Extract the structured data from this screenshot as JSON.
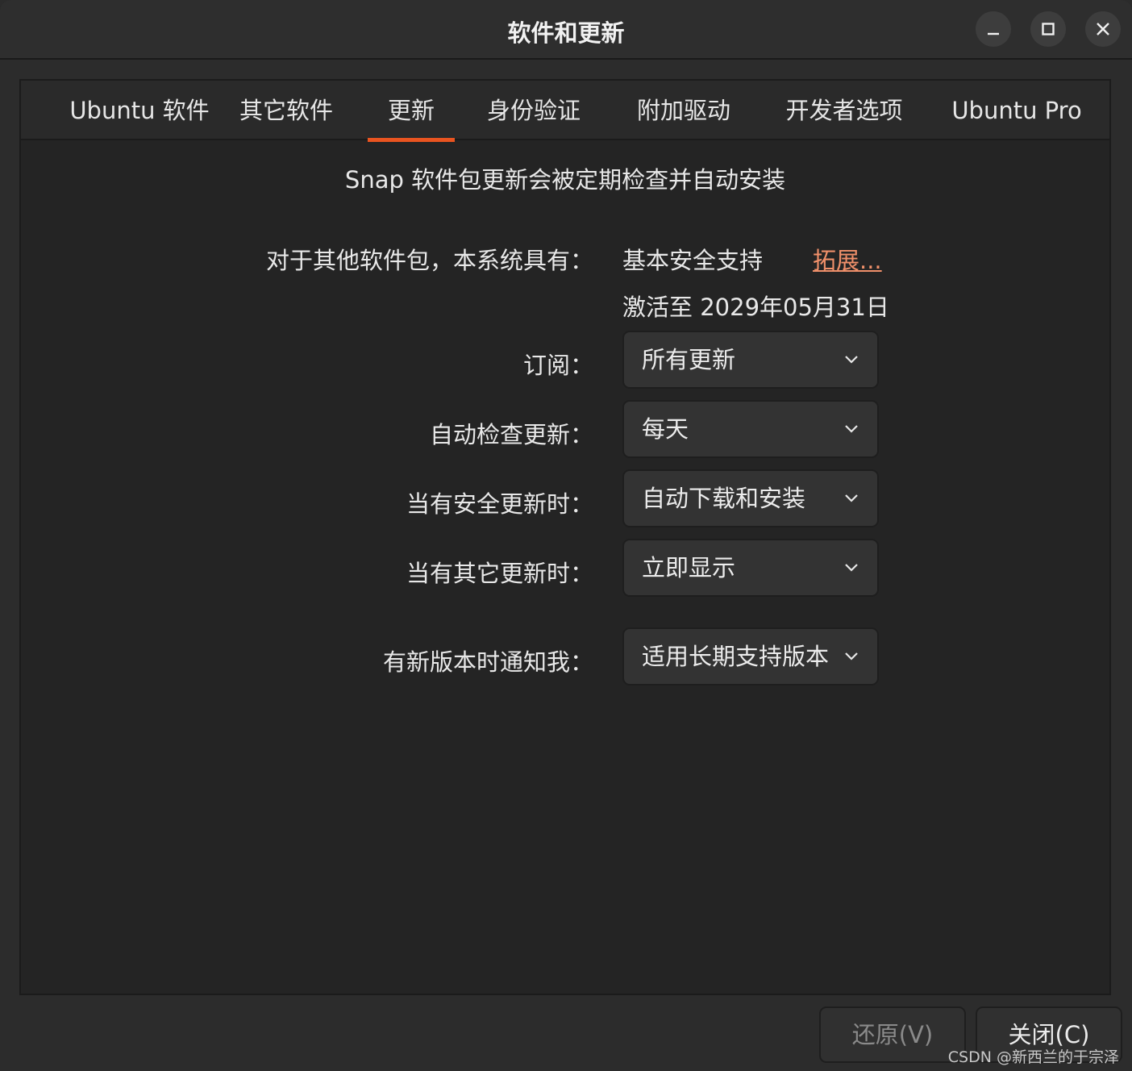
{
  "window": {
    "title": "软件和更新"
  },
  "tabs": [
    {
      "label": "Ubuntu 软件"
    },
    {
      "label": "其它软件"
    },
    {
      "label": "更新"
    },
    {
      "label": "身份验证"
    },
    {
      "label": "附加驱动"
    },
    {
      "label": "开发者选项"
    },
    {
      "label": "Ubuntu Pro"
    }
  ],
  "active_tab": "更新",
  "updates": {
    "snap_note": "Snap 软件包更新会被定期检查并自动安装",
    "support_label": "对于其他软件包，本系统具有：",
    "support_value": "基本安全支持",
    "extend_link": "拓展...",
    "activated_until": "激活至 2029年05月31日",
    "subscription_label": "订阅：",
    "subscription_value": "所有更新",
    "auto_check_label": "自动检查更新：",
    "auto_check_value": "每天",
    "security_updates_label": "当有安全更新时：",
    "security_updates_value": "自动下载和安装",
    "other_updates_label": "当有其它更新时：",
    "other_updates_value": "立即显示",
    "notify_label": "有新版本时通知我：",
    "notify_value": "适用长期支持版本"
  },
  "buttons": {
    "revert": "还原(V)",
    "close": "关闭(C)"
  },
  "watermark": "CSDN @新西兰的于宗泽",
  "colors": {
    "accent": "#e95420",
    "link": "#f0906a"
  },
  "icons": {
    "minimize": "minimize-icon",
    "maximize": "maximize-icon",
    "close": "close-icon",
    "dropdown": "chevron-down-icon"
  }
}
